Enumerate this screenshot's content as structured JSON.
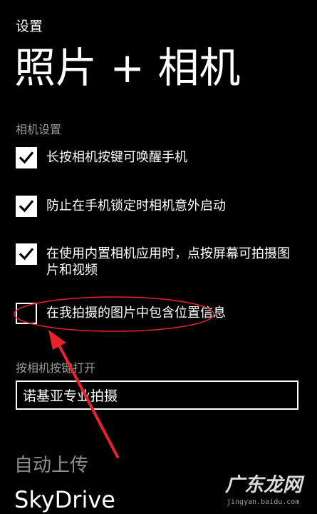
{
  "header": {
    "app_label": "设置",
    "title": "照片 + 相机"
  },
  "camera_settings": {
    "section_label": "相机设置",
    "options": [
      {
        "label": "长按相机按键可唤醒手机",
        "checked": true
      },
      {
        "label": "防止在手机锁定时相机意外启动",
        "checked": true
      },
      {
        "label": "在使用内置相机应用时，点按屏幕可拍摄图片和视频",
        "checked": true
      },
      {
        "label": "在我拍摄的图片中包含位置信息",
        "checked": false
      }
    ]
  },
  "camera_button": {
    "section_label": "按相机按键打开",
    "value": "诺基亚专业拍摄"
  },
  "auto_upload": {
    "heading": "自动上传",
    "value": "SkyDrive"
  },
  "annotation": {
    "color": "#e8222a"
  },
  "watermark": {
    "text": "广东龙网",
    "url": "jingyan.baidu.com"
  }
}
